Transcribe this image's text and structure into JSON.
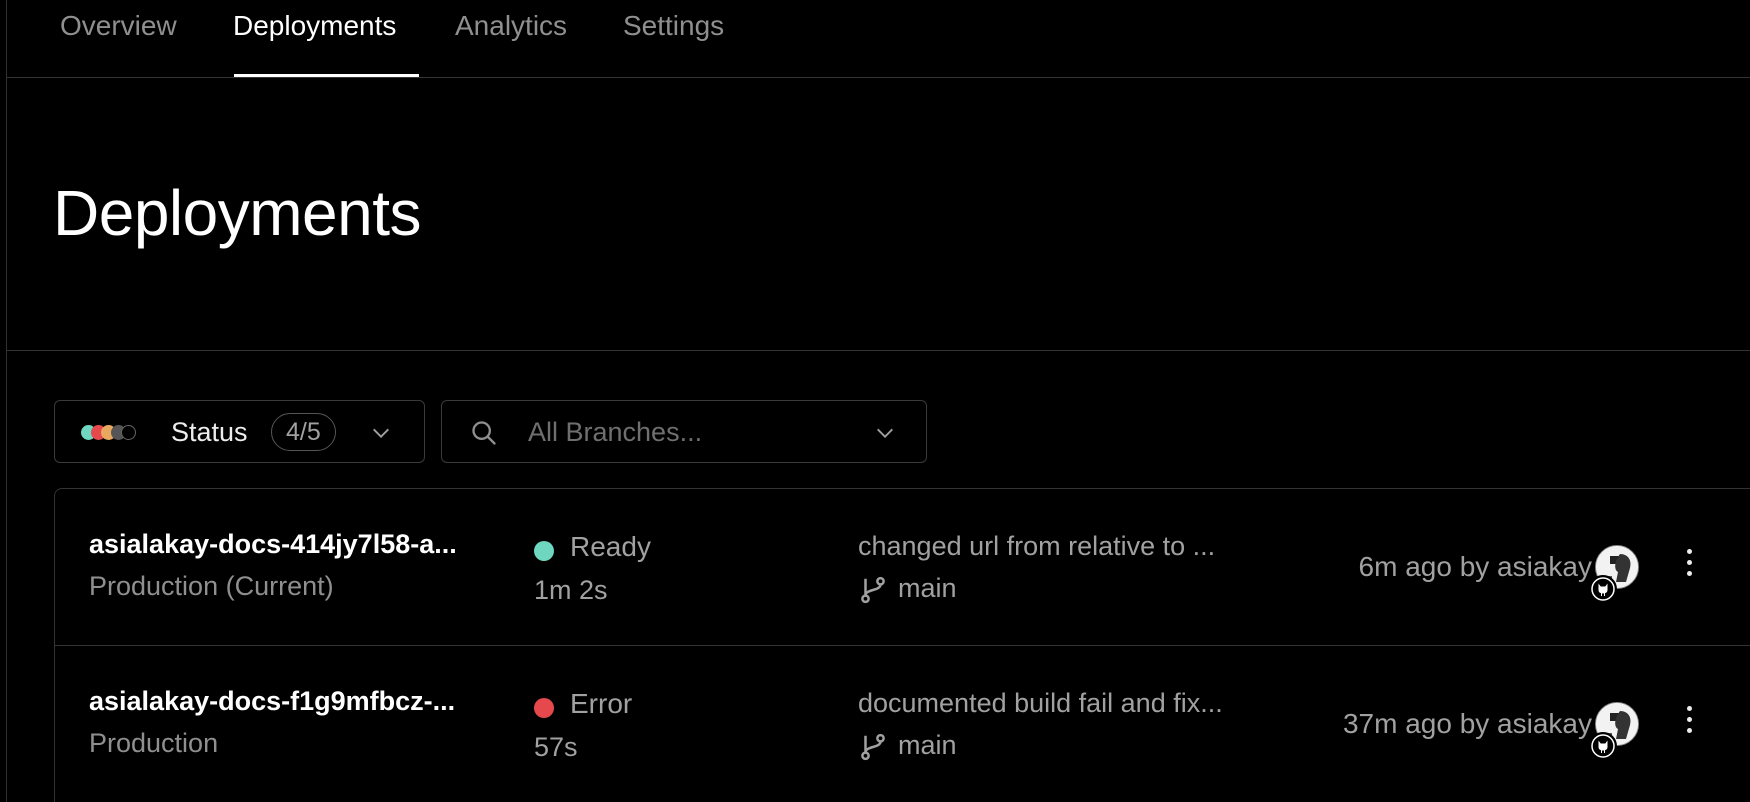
{
  "tabs": [
    {
      "label": "Overview"
    },
    {
      "label": "Deployments",
      "active": true
    },
    {
      "label": "Analytics"
    },
    {
      "label": "Settings"
    }
  ],
  "page_title": "Deployments",
  "filters": {
    "status_label": "Status",
    "status_count": "4/5",
    "status_dot_colors": [
      "#6fd6c0",
      "#e5484d",
      "#e8a85f",
      "#555555",
      "#000000"
    ],
    "branch_placeholder": "All Branches...",
    "branch_value": ""
  },
  "deployments": [
    {
      "name": "asialakay-docs-414jy7l58-a...",
      "environment": "Production (Current)",
      "status": "Ready",
      "status_color": "#6fd6c0",
      "duration": "1m 2s",
      "commit_message": "changed url from relative to ...",
      "branch": "main",
      "time_by": "6m ago by asiakay"
    },
    {
      "name": "asialakay-docs-f1g9mfbcz-...",
      "environment": "Production",
      "status": "Error",
      "status_color": "#e5484d",
      "duration": "57s",
      "commit_message": "documented build fail and fix...",
      "branch": "main",
      "time_by": "37m ago by asiakay"
    }
  ]
}
